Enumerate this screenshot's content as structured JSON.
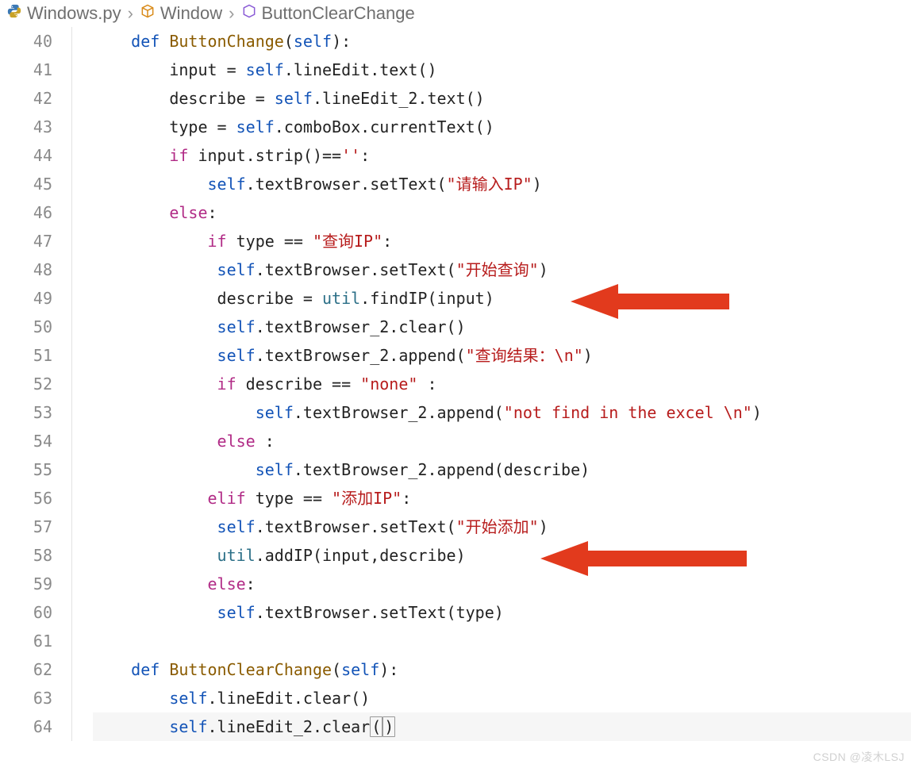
{
  "breadcrumbs": {
    "file_icon": "python-icon",
    "file": "Windows.py",
    "class_icon": "class-icon",
    "class": "Window",
    "method_icon": "method-icon",
    "method": "ButtonClearChange"
  },
  "line_numbers": [
    "40",
    "41",
    "42",
    "43",
    "44",
    "45",
    "46",
    "47",
    "48",
    "49",
    "50",
    "51",
    "52",
    "53",
    "54",
    "55",
    "56",
    "57",
    "58",
    "59",
    "60",
    "61",
    "62",
    "63",
    "64"
  ],
  "code": {
    "l40": {
      "kw": "def ",
      "fn": "ButtonChange",
      "params": "(",
      "self": "self",
      "paren_close": "):"
    },
    "l41": {
      "text_a": "input = ",
      "self": "self",
      "text_b": ".lineEdit.text()"
    },
    "l42": {
      "text_a": "describe = ",
      "self": "self",
      "text_b": ".lineEdit_2.text()"
    },
    "l43": {
      "text_a": "type = ",
      "self": "self",
      "text_b": ".comboBox.currentText()"
    },
    "l44": {
      "kw": "if ",
      "text_a": "input.strip()==",
      "str": "''",
      "colon": ":"
    },
    "l45": {
      "self": "self",
      "text_a": ".textBrowser.setText(",
      "str": "\"请输入IP\"",
      "text_b": ")"
    },
    "l46": {
      "kw": "else",
      "colon": ":"
    },
    "l47": {
      "kw": "if ",
      "text_a": "type == ",
      "str": "\"查询IP\"",
      "colon": ":"
    },
    "l48": {
      "self": "self",
      "text_a": ".textBrowser.setText(",
      "str": "\"开始查询\"",
      "text_b": ")"
    },
    "l49": {
      "text_a": "describe = ",
      "util": "util",
      "text_b": ".findIP(input)"
    },
    "l50": {
      "self": "self",
      "text_a": ".textBrowser_2.clear()"
    },
    "l51": {
      "self": "self",
      "text_a": ".textBrowser_2.append(",
      "str": "\"查询结果：\\n\"",
      "text_b": ")"
    },
    "l52": {
      "kw": "if ",
      "text_a": "describe == ",
      "str": "\"none\"",
      "colon": " :"
    },
    "l53": {
      "self": "self",
      "text_a": ".textBrowser_2.append(",
      "str": "\"not find in the excel \\n\"",
      "text_b": ")"
    },
    "l54": {
      "kw": "else",
      "colon": " :"
    },
    "l55": {
      "self": "self",
      "text_a": ".textBrowser_2.append(describe)"
    },
    "l56": {
      "kw": "elif ",
      "text_a": "type == ",
      "str": "\"添加IP\"",
      "colon": ":"
    },
    "l57": {
      "self": "self",
      "text_a": ".textBrowser.setText(",
      "str": "\"开始添加\"",
      "text_b": ")"
    },
    "l58": {
      "util": "util",
      "text_a": ".addIP(input,describe)"
    },
    "l59": {
      "kw": "else",
      "colon": ":"
    },
    "l60": {
      "self": "self",
      "text_a": ".textBrowser.setText(type)"
    },
    "l61": {
      "text": ""
    },
    "l62": {
      "kw": "def ",
      "fn": "ButtonClearChange",
      "params": "(",
      "self": "self",
      "paren_close": "):"
    },
    "l63": {
      "self": "self",
      "text_a": ".lineEdit.clear()"
    },
    "l64": {
      "self": "self",
      "text_a": ".lineEdit_2.clear",
      "hl_open": "(",
      "hl_close": ")"
    }
  },
  "arrows": {
    "color": "#e23a1d"
  },
  "watermark": "CSDN @凌木LSJ"
}
